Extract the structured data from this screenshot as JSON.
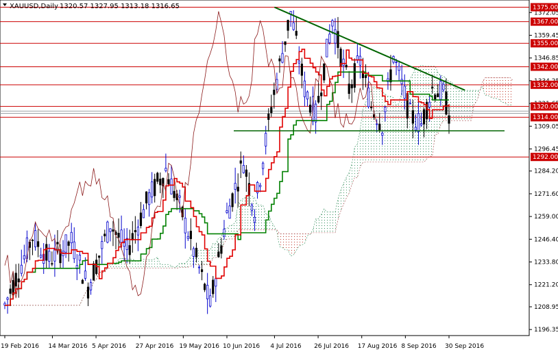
{
  "chart_data": {
    "type": "candlestick",
    "title": "XAUUSD,Daily",
    "ohlc_readout": "1320.57 1327.95 1313.18 1316.65",
    "ylim": [
      1193.0,
      1379.0
    ],
    "y_ticks": [
      "1372.05",
      "1359.45",
      "1346.85",
      "1334.25",
      "1321.65",
      "1309.05",
      "1296.45",
      "1284.20",
      "1271.60",
      "1259.00",
      "1246.40",
      "1233.80",
      "1221.20",
      "1208.95",
      "1196.35"
    ],
    "x_ticks": [
      "19 Feb 2016",
      "14 Mar 2016",
      "5 Apr 2016",
      "27 Apr 2016",
      "19 May 2016",
      "10 Jun 2016",
      "4 Jul 2016",
      "26 Jul 2016",
      "17 Aug 2016",
      "8 Sep 2016",
      "30 Sep 2016"
    ],
    "resistance_levels": [
      {
        "label": "1375.00",
        "value": 1375.0
      },
      {
        "label": "1367.00",
        "value": 1367.0
      },
      {
        "label": "1355.00",
        "value": 1355.0
      },
      {
        "label": "1342.00",
        "value": 1342.0
      },
      {
        "label": "1332.00",
        "value": 1332.0
      },
      {
        "label": "1320.00",
        "value": 1320.0
      },
      {
        "label": "1314.00",
        "value": 1314.0
      },
      {
        "label": "1292.00",
        "value": 1292.0
      }
    ],
    "current_price": 1316.65,
    "trendline_down": [
      {
        "x": "4 Jul 2016",
        "y": 1375.0
      },
      {
        "x": "8 Oct 2016",
        "y": 1329.0
      }
    ],
    "support_line": {
      "value": 1306.5
    },
    "colors": {
      "bull": "#0000cc",
      "bear": "#000000",
      "level": "#cc0000",
      "tenkan": "#e00000",
      "kijun": "#008000",
      "chikou": "#8b1a1a",
      "trendline": "#006400",
      "badge": "#cc0000"
    },
    "series": [
      {
        "name": "Tenkan-sen",
        "color": "#e00000"
      },
      {
        "name": "Kijun-sen",
        "color": "#008000"
      },
      {
        "name": "Chikou Span",
        "color": "#8b1a1a"
      }
    ]
  }
}
